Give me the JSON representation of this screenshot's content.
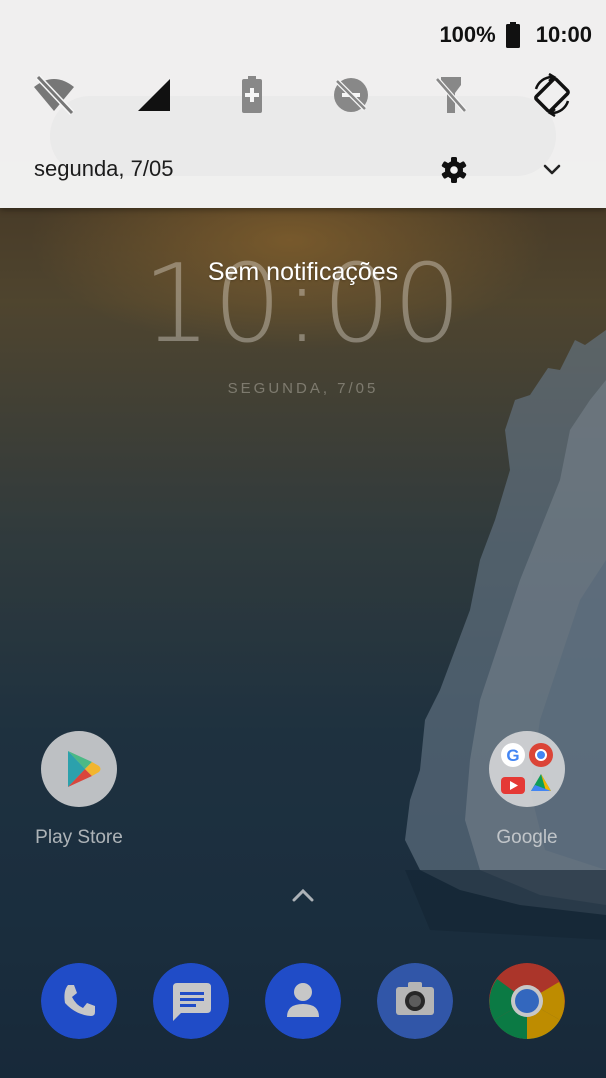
{
  "status_bar": {
    "battery_percent": "100%",
    "time": "10:00",
    "icons": [
      "battery-full-icon"
    ]
  },
  "quick_settings": {
    "tiles": [
      {
        "name": "wifi-off-icon",
        "enabled": false
      },
      {
        "name": "cellular-signal-icon",
        "enabled": true
      },
      {
        "name": "battery-saver-icon",
        "enabled": false
      },
      {
        "name": "do-not-disturb-off-icon",
        "enabled": false
      },
      {
        "name": "flashlight-off-icon",
        "enabled": false
      },
      {
        "name": "auto-rotate-icon",
        "enabled": true
      }
    ],
    "date": "segunda, 7/05",
    "settings_icon": "gear-icon",
    "expand_icon": "chevron-down-icon"
  },
  "notifications": {
    "empty_text": "Sem notificações"
  },
  "home_screen": {
    "clock": "10:00",
    "date": "SEGUNDA, 7/05",
    "apps": [
      {
        "label": "Play Store",
        "icon": "play-store-icon"
      },
      {
        "label": "Google",
        "icon": "google-folder-icon"
      }
    ],
    "drawer_icon": "chevron-up-icon",
    "dock": [
      {
        "name": "phone-icon",
        "color": "#2962ff"
      },
      {
        "name": "messages-icon",
        "color": "#2962ff"
      },
      {
        "name": "contacts-icon",
        "color": "#2962ff"
      },
      {
        "name": "camera-icon",
        "color": "#3f6fd8"
      },
      {
        "name": "chrome-icon",
        "color": "#db4437"
      }
    ]
  },
  "colors": {
    "shade_bg": "#f6f6f6",
    "dock_blue": "#2962ff",
    "text_dark": "#1c1c1c"
  }
}
